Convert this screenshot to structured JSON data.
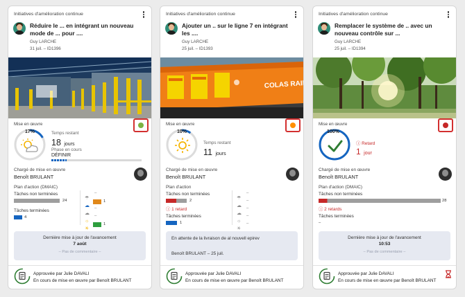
{
  "cards": [
    {
      "initiative_label": "Initiatives d'amélioration continue",
      "title": "Réduire le ... en intégrant un nouveau mode de ... pour ....",
      "author": "Guy LARCHE",
      "date_id": "31 juil. – ID1396",
      "photo": "warehouse-yellow-bollards",
      "mise_label": "Mise en œuvre",
      "status_color": "#7cb342",
      "progress_percent": "17%",
      "progress_value": 17,
      "weather_icon": "sun-cloud-icon",
      "time_label": "Temps restant",
      "time_value": "18",
      "time_unit": "jours",
      "phase_label": "Phase en cours",
      "phase_value": "DÉFINIR",
      "charge_label": "Chargé de mise en œuvre",
      "charge_name": "Benoît BRULANT",
      "plan_label": "Plan d'action (DMAIC)",
      "non_term_label": "Tâches non terminées",
      "non_term_count": "24",
      "term_label": "Tâches terminées",
      "term_count": "4",
      "weather_counts": [
        "–",
        "1",
        "–",
        "–",
        "1"
      ],
      "update_title": "Dernière mise à jour de l'avancement",
      "update_value": "7 août",
      "update_comment": "– Pas de commentaire –",
      "approved": "Approuvée par Julie DAVALI",
      "in_progress": "En cours de mise en œuvre par Benoît BRULANT"
    },
    {
      "initiative_label": "Initiatives d'amélioration continue",
      "title": "Ajouter un .. sur le ligne 7 en intégrant les ....",
      "author": "Guy LARCHE",
      "date_id": "25 juil. – ID1393",
      "photo": "orange-rail-locomotive",
      "photo_text": "COLAS RAIL",
      "mise_label": "Mise en œuvre",
      "status_color": "#ff8f00",
      "progress_percent": "10%",
      "progress_value": 10,
      "weather_icon": "sun-icon",
      "time_label": "Temps restant",
      "time_value": "11",
      "time_unit": "jours",
      "charge_label": "Chargé de mise en œuvre",
      "charge_name": "Benoît BRULANT",
      "plan_label": "Plan d'action",
      "non_term_label": "Tâches non terminées",
      "non_term_count": "2",
      "retard_label": "1 retard",
      "term_label": "Tâches terminées",
      "term_count": "1",
      "weather_counts": [
        "–",
        "–",
        "–",
        "–",
        "–"
      ],
      "update_text": "En attente de la livraison de al nouvell epirev",
      "update_by": "Benoît BRULANT – 25 juil.",
      "approved": "Approuvée par Julie DAVALI",
      "in_progress": "En cours de mise en œuvre par Benoît BRULANT"
    },
    {
      "initiative_label": "Initiatives d'amélioration continue",
      "title": "Remplacer le système de .. avec un nouveau contrôle sur ...",
      "author": "Guy LARCHE",
      "date_id": "25 juil. – ID1394",
      "photo": "trees-sunlight",
      "mise_label": "Mise en œuvre",
      "status_color": "#c62828",
      "progress_percent": "100%",
      "progress_value": 100,
      "weather_icon": "check-icon",
      "retard_title": "Retard",
      "retard_value": "1",
      "retard_unit": "jour",
      "charge_label": "Chargé de mise en œuvre",
      "charge_name": "Benoît BRULANT",
      "plan_label": "Plan d'action (DMAIC)",
      "non_term_label": "Tâches non terminées",
      "non_term_count": "28",
      "retard_label": "2 retards",
      "term_label": "Tâches terminées",
      "term_count": "–",
      "update_title": "Dernière mise à jour de l'avancement",
      "update_value": "10:53",
      "update_comment": "– Pas de commentaire –",
      "approved": "Approuvée par Julie DAVALI",
      "in_progress": "En cours de mise en œuvre par Benoît BRULANT"
    }
  ],
  "colors": {
    "accent_blue": "#1565c0",
    "status_red": "#c62828",
    "status_orange": "#ff8f00",
    "status_green": "#7cb342"
  }
}
